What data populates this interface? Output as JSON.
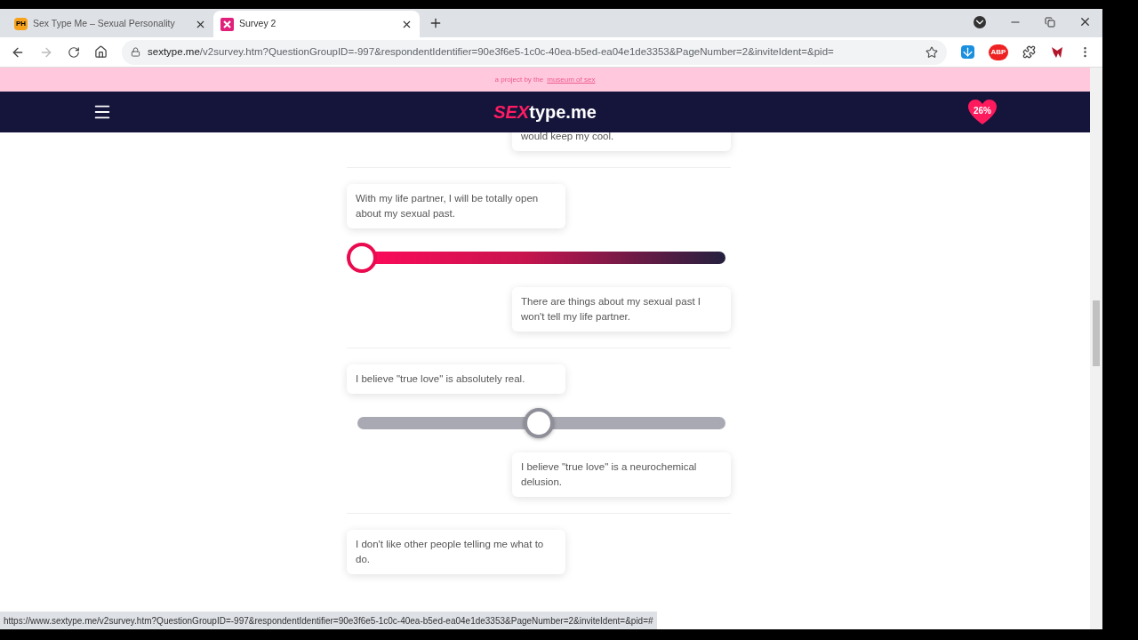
{
  "browser": {
    "tabs": [
      {
        "title": "Sex Type Me – Sexual Personality",
        "kind": "ph",
        "favicon_text": "PH",
        "selected": false
      },
      {
        "title": "Survey 2",
        "kind": "x",
        "selected": true
      }
    ],
    "url": {
      "host": "sextype.me",
      "path": "/v2survey.htm?QuestionGroupID=-997&respondentIdentifier=90e3f6e5-1c0c-40ea-b5ed-ea04e1de3353&PageNumber=2&inviteIdent=&pid="
    },
    "abp_label": "ABP",
    "status_url": "https://www.sextype.me/v2survey.htm?QuestionGroupID=-997&respondentIdentifier=90e3f6e5-1c0c-40ea-b5ed-ea04e1de3353&PageNumber=2&inviteIdent=&pid=#"
  },
  "banner": {
    "text": "a project by the",
    "link": "museum of sex"
  },
  "header": {
    "logo_accent": "SEX",
    "logo_rest": "type.me",
    "progress": "26%"
  },
  "questions": [
    {
      "right": "would keep my cool."
    },
    {
      "left": "With my life partner, I will be totally open about my sexual past.",
      "right": "There are things about my sexual past I won't tell my life partner.",
      "answered": true,
      "level": 0
    },
    {
      "left": "I believe \"true love\" is absolutely real.",
      "right": "I believe \"true love\" is a neurochemical delusion.",
      "answered": false,
      "level": 0.5
    },
    {
      "left": "I don't like other people telling me what to do."
    }
  ]
}
